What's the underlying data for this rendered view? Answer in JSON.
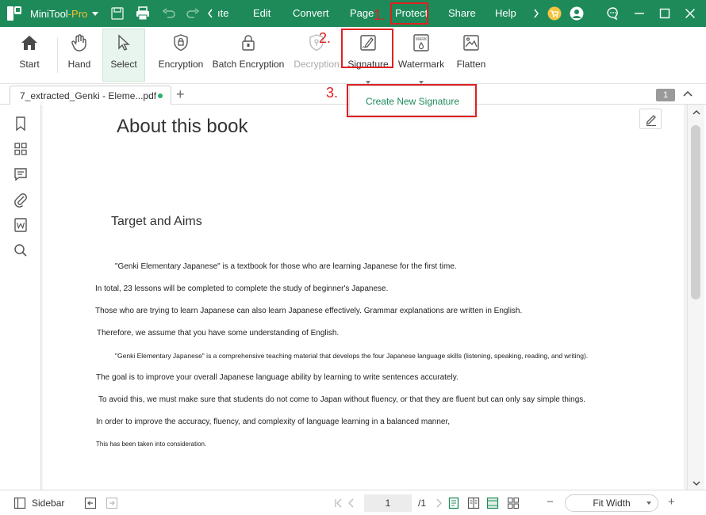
{
  "app": {
    "name": "MiniTool",
    "edition": "-Pro",
    "brand_color": "#1e8a5a"
  },
  "menu": {
    "items": [
      "ıte",
      "Edit",
      "Convert",
      "Page",
      "Protect",
      "Share",
      "Help"
    ],
    "active": "Protect"
  },
  "ribbon": {
    "tools": [
      {
        "label": "Start",
        "icon": "home-icon"
      },
      {
        "label": "Hand",
        "icon": "hand-icon"
      },
      {
        "label": "Select",
        "icon": "cursor-icon"
      },
      {
        "label": "Encryption",
        "icon": "lock-icon"
      },
      {
        "label": "Batch Encryption",
        "icon": "lock-stack-icon"
      },
      {
        "label": "Decryption",
        "icon": "shield-key-icon"
      },
      {
        "label": "Signature",
        "icon": "signature-icon"
      },
      {
        "label": "Watermark",
        "icon": "watermark-icon"
      },
      {
        "label": "Flatten",
        "icon": "flatten-icon"
      }
    ],
    "watermark_icon_text": "MARK"
  },
  "tabs": {
    "doc_name": "7_extracted_Genki - Eleme...pdf",
    "page_badge": "1"
  },
  "dropdown": {
    "item": "Create New Signature"
  },
  "annotations": {
    "step1": "1.",
    "step2": "2.",
    "step3": "3."
  },
  "document": {
    "title": "About this book",
    "subtitle": "Target and Aims",
    "lines": [
      "\"Genki Elementary Japanese\" is a textbook for those who are learning Japanese for the first time.",
      "In total, 23 lessons will be completed to complete the study of beginner's Japanese.",
      "Those who are trying to learn Japanese can also learn Japanese effectively. Grammar explanations are written in English.",
      "Therefore, we assume that you have some understanding of English.",
      "\"Genki Elementary Japanese\" is a comprehensive teaching material that develops the four Japanese language skills (listening, speaking, reading, and writing).",
      "The goal is to improve your overall Japanese language ability by learning to write sentences accurately.",
      "To avoid this, we must make sure that students do not come to Japan without fluency, or that they are fluent but can only say simple things.",
      "In order to improve the accuracy, fluency, and complexity of language learning in a balanced manner,",
      "This has been taken into consideration."
    ]
  },
  "statusbar": {
    "sidebar_label": "Sidebar",
    "page_current": "1",
    "page_total": "/1",
    "zoom": "Fit Width",
    "zoom_minus": "−",
    "zoom_plus": "+"
  }
}
